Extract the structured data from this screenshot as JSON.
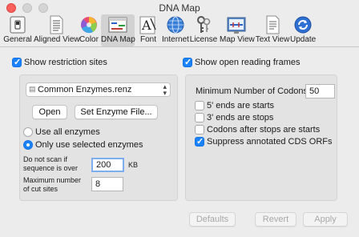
{
  "window": {
    "title": "DNA Map"
  },
  "toolbar": {
    "items": [
      {
        "label": "General",
        "icon": "switch-icon"
      },
      {
        "label": "Aligned View",
        "icon": "aligned-doc-icon"
      },
      {
        "label": "Color",
        "icon": "color-wheel-icon"
      },
      {
        "label": "DNA Map",
        "icon": "dna-map-icon",
        "active": true
      },
      {
        "label": "Font",
        "icon": "font-icon"
      },
      {
        "label": "Internet",
        "icon": "globe-icon"
      },
      {
        "label": "License",
        "icon": "keys-icon"
      },
      {
        "label": "Map View",
        "icon": "map-view-icon"
      },
      {
        "label": "Text View",
        "icon": "text-view-icon"
      },
      {
        "label": "Update",
        "icon": "update-icon"
      }
    ]
  },
  "restriction": {
    "show_label": "Show restriction sites",
    "show_checked": true,
    "enzyme_file": "Common Enzymes.renz",
    "open_label": "Open",
    "set_file_label": "Set Enzyme File...",
    "use_all_label": "Use all enzymes",
    "use_selected_label": "Only use selected enzymes",
    "selected_option": "use_selected",
    "no_scan_line1": "Do not scan if",
    "no_scan_line2": "sequence is over",
    "no_scan_value": "200",
    "no_scan_unit": "KB",
    "max_cut_line1": "Maximum number",
    "max_cut_line2": "of cut sites",
    "max_cut_value": "8"
  },
  "orf": {
    "show_label": "Show open reading frames",
    "show_checked": true,
    "min_codons_label": "Minimum Number of Codons:",
    "min_codons_value": "50",
    "opt_5prime": "5' ends are starts",
    "opt_3prime": "3' ends are stops",
    "opt_codons_after": "Codons after stops are starts",
    "opt_suppress": "Suppress annotated CDS ORFs",
    "checked": {
      "opt_5prime": false,
      "opt_3prime": false,
      "opt_codons_after": false,
      "opt_suppress": true
    }
  },
  "footer": {
    "defaults_label": "Defaults",
    "revert_label": "Revert",
    "apply_label": "Apply"
  },
  "colors": {
    "accent": "#1a82fb",
    "close": "#fc605c",
    "background": "#ececec"
  }
}
